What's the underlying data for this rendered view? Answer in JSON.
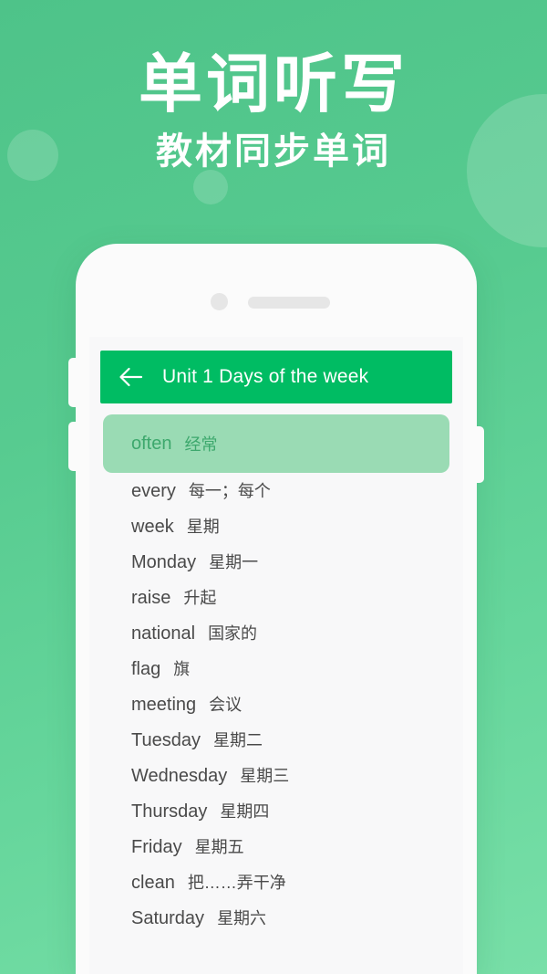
{
  "hero": {
    "title": "单词听写",
    "subtitle": "教材同步单词"
  },
  "colors": {
    "background_green": "#52c98a",
    "header_green": "#00bc63",
    "highlight_bg": "#9adbb4",
    "highlight_text": "#3da86d",
    "screen_bg": "#f8f8f9",
    "phone_body": "#fbfbfb",
    "word_text": "#4a4a4a"
  },
  "phone": {
    "camera_icon": "camera-dot",
    "speaker_icon": "speaker-slot"
  },
  "app": {
    "header": {
      "back_icon": "arrow-left-icon",
      "title": "Unit 1 Days of the week"
    },
    "words": [
      {
        "en": "often",
        "cn": "经常",
        "active": true
      },
      {
        "en": "every",
        "cn": "每一；每个",
        "active": false
      },
      {
        "en": "week",
        "cn": "星期",
        "active": false
      },
      {
        "en": "Monday",
        "cn": "星期一",
        "active": false
      },
      {
        "en": "raise",
        "cn": "升起",
        "active": false
      },
      {
        "en": "national",
        "cn": "国家的",
        "active": false
      },
      {
        "en": "flag",
        "cn": "旗",
        "active": false
      },
      {
        "en": "meeting",
        "cn": "会议",
        "active": false
      },
      {
        "en": "Tuesday",
        "cn": "星期二",
        "active": false
      },
      {
        "en": "Wednesday",
        "cn": "星期三",
        "active": false
      },
      {
        "en": "Thursday",
        "cn": "星期四",
        "active": false
      },
      {
        "en": "Friday",
        "cn": "星期五",
        "active": false
      },
      {
        "en": "clean",
        "cn": "把……弄干净",
        "active": false
      },
      {
        "en": "Saturday",
        "cn": "星期六",
        "active": false
      }
    ]
  }
}
